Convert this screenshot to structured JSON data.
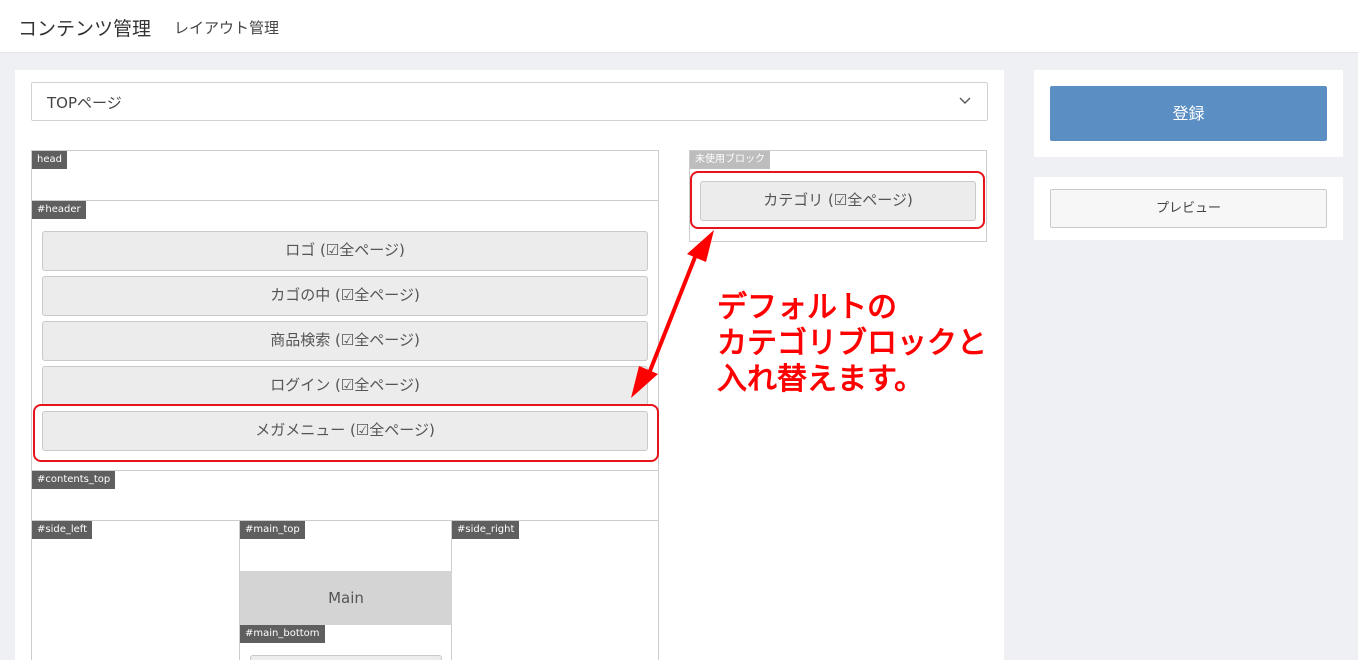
{
  "header": {
    "title": "コンテンツ管理",
    "subtitle": "レイアウト管理"
  },
  "page_select": {
    "value": "TOPページ"
  },
  "layout": {
    "head": {
      "tag": "head"
    },
    "header": {
      "tag": "#header",
      "blocks": [
        "ロゴ (☑全ページ)",
        "カゴの中 (☑全ページ)",
        "商品検索 (☑全ページ)",
        "ログイン (☑全ページ)",
        "メガメニュー (☑全ページ)"
      ]
    },
    "contents_top": {
      "tag": "#contents_top"
    },
    "side_left": {
      "tag": "#side_left"
    },
    "main_top": {
      "tag": "#main_top"
    },
    "main": {
      "label": "Main"
    },
    "main_bottom": {
      "tag": "#main_bottom"
    },
    "side_right": {
      "tag": "#side_right"
    }
  },
  "unused": {
    "tag": "未使用ブロック",
    "blocks": [
      "カテゴリ (☑全ページ)"
    ]
  },
  "annotation": {
    "lines": [
      "デフォルトの",
      "カテゴリブロックと",
      "入れ替えます。"
    ],
    "color": "#ff0000"
  },
  "actions": {
    "register_label": "登録",
    "preview_label": "プレビュー"
  },
  "colors": {
    "primary": "#5b8fc4",
    "highlight": "#e8141c"
  }
}
